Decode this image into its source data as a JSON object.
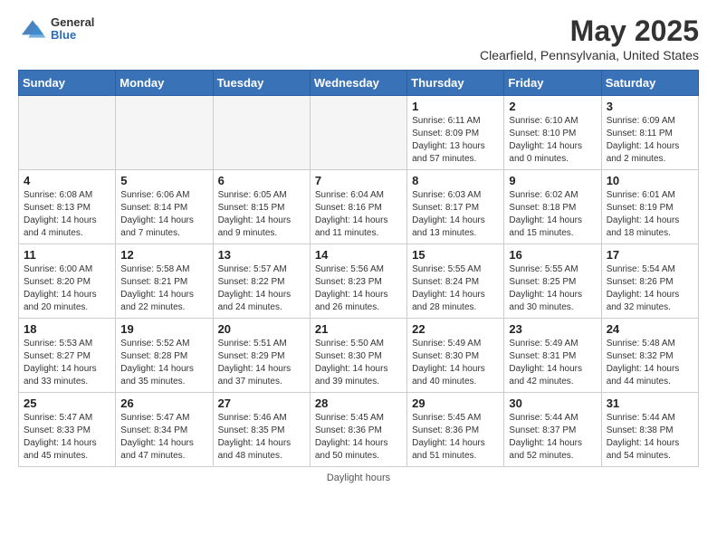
{
  "header": {
    "logo_general": "General",
    "logo_blue": "Blue",
    "month_title": "May 2025",
    "location": "Clearfield, Pennsylvania, United States"
  },
  "weekdays": [
    "Sunday",
    "Monday",
    "Tuesday",
    "Wednesday",
    "Thursday",
    "Friday",
    "Saturday"
  ],
  "weeks": [
    [
      {
        "day": "",
        "empty": true
      },
      {
        "day": "",
        "empty": true
      },
      {
        "day": "",
        "empty": true
      },
      {
        "day": "",
        "empty": true
      },
      {
        "day": "1",
        "sunrise": "6:11 AM",
        "sunset": "8:09 PM",
        "daylight": "13 hours and 57 minutes."
      },
      {
        "day": "2",
        "sunrise": "6:10 AM",
        "sunset": "8:10 PM",
        "daylight": "14 hours and 0 minutes."
      },
      {
        "day": "3",
        "sunrise": "6:09 AM",
        "sunset": "8:11 PM",
        "daylight": "14 hours and 2 minutes."
      }
    ],
    [
      {
        "day": "4",
        "sunrise": "6:08 AM",
        "sunset": "8:13 PM",
        "daylight": "14 hours and 4 minutes."
      },
      {
        "day": "5",
        "sunrise": "6:06 AM",
        "sunset": "8:14 PM",
        "daylight": "14 hours and 7 minutes."
      },
      {
        "day": "6",
        "sunrise": "6:05 AM",
        "sunset": "8:15 PM",
        "daylight": "14 hours and 9 minutes."
      },
      {
        "day": "7",
        "sunrise": "6:04 AM",
        "sunset": "8:16 PM",
        "daylight": "14 hours and 11 minutes."
      },
      {
        "day": "8",
        "sunrise": "6:03 AM",
        "sunset": "8:17 PM",
        "daylight": "14 hours and 13 minutes."
      },
      {
        "day": "9",
        "sunrise": "6:02 AM",
        "sunset": "8:18 PM",
        "daylight": "14 hours and 15 minutes."
      },
      {
        "day": "10",
        "sunrise": "6:01 AM",
        "sunset": "8:19 PM",
        "daylight": "14 hours and 18 minutes."
      }
    ],
    [
      {
        "day": "11",
        "sunrise": "6:00 AM",
        "sunset": "8:20 PM",
        "daylight": "14 hours and 20 minutes."
      },
      {
        "day": "12",
        "sunrise": "5:58 AM",
        "sunset": "8:21 PM",
        "daylight": "14 hours and 22 minutes."
      },
      {
        "day": "13",
        "sunrise": "5:57 AM",
        "sunset": "8:22 PM",
        "daylight": "14 hours and 24 minutes."
      },
      {
        "day": "14",
        "sunrise": "5:56 AM",
        "sunset": "8:23 PM",
        "daylight": "14 hours and 26 minutes."
      },
      {
        "day": "15",
        "sunrise": "5:55 AM",
        "sunset": "8:24 PM",
        "daylight": "14 hours and 28 minutes."
      },
      {
        "day": "16",
        "sunrise": "5:55 AM",
        "sunset": "8:25 PM",
        "daylight": "14 hours and 30 minutes."
      },
      {
        "day": "17",
        "sunrise": "5:54 AM",
        "sunset": "8:26 PM",
        "daylight": "14 hours and 32 minutes."
      }
    ],
    [
      {
        "day": "18",
        "sunrise": "5:53 AM",
        "sunset": "8:27 PM",
        "daylight": "14 hours and 33 minutes."
      },
      {
        "day": "19",
        "sunrise": "5:52 AM",
        "sunset": "8:28 PM",
        "daylight": "14 hours and 35 minutes."
      },
      {
        "day": "20",
        "sunrise": "5:51 AM",
        "sunset": "8:29 PM",
        "daylight": "14 hours and 37 minutes."
      },
      {
        "day": "21",
        "sunrise": "5:50 AM",
        "sunset": "8:30 PM",
        "daylight": "14 hours and 39 minutes."
      },
      {
        "day": "22",
        "sunrise": "5:49 AM",
        "sunset": "8:30 PM",
        "daylight": "14 hours and 40 minutes."
      },
      {
        "day": "23",
        "sunrise": "5:49 AM",
        "sunset": "8:31 PM",
        "daylight": "14 hours and 42 minutes."
      },
      {
        "day": "24",
        "sunrise": "5:48 AM",
        "sunset": "8:32 PM",
        "daylight": "14 hours and 44 minutes."
      }
    ],
    [
      {
        "day": "25",
        "sunrise": "5:47 AM",
        "sunset": "8:33 PM",
        "daylight": "14 hours and 45 minutes."
      },
      {
        "day": "26",
        "sunrise": "5:47 AM",
        "sunset": "8:34 PM",
        "daylight": "14 hours and 47 minutes."
      },
      {
        "day": "27",
        "sunrise": "5:46 AM",
        "sunset": "8:35 PM",
        "daylight": "14 hours and 48 minutes."
      },
      {
        "day": "28",
        "sunrise": "5:45 AM",
        "sunset": "8:36 PM",
        "daylight": "14 hours and 50 minutes."
      },
      {
        "day": "29",
        "sunrise": "5:45 AM",
        "sunset": "8:36 PM",
        "daylight": "14 hours and 51 minutes."
      },
      {
        "day": "30",
        "sunrise": "5:44 AM",
        "sunset": "8:37 PM",
        "daylight": "14 hours and 52 minutes."
      },
      {
        "day": "31",
        "sunrise": "5:44 AM",
        "sunset": "8:38 PM",
        "daylight": "14 hours and 54 minutes."
      }
    ]
  ],
  "footer": {
    "daylight_label": "Daylight hours"
  }
}
